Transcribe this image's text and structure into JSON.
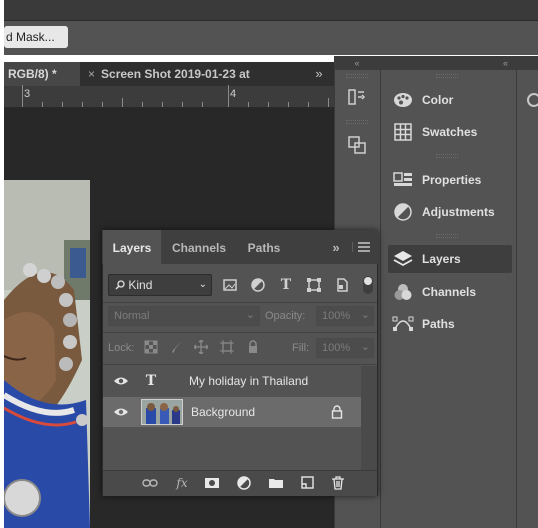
{
  "options_bar": {
    "mask_button": "d Mask..."
  },
  "tabs": {
    "active": "RGB/8) *",
    "inactive": "Screen Shot 2019-01-23 at",
    "close_glyph": "×",
    "overflow": "»"
  },
  "ruler": {
    "marks": [
      "3",
      "4"
    ]
  },
  "collapse": {
    "left": "«",
    "right": "«"
  },
  "right_panel": {
    "items": [
      {
        "label": "Color",
        "icon": "color-palette-icon"
      },
      {
        "label": "Swatches",
        "icon": "swatches-grid-icon"
      },
      {
        "label": "Properties",
        "icon": "properties-icon"
      },
      {
        "label": "Adjustments",
        "icon": "adjustments-circle-icon"
      },
      {
        "label": "Layers",
        "icon": "layers-stack-icon",
        "selected": true
      },
      {
        "label": "Channels",
        "icon": "channels-icon"
      },
      {
        "label": "Paths",
        "icon": "paths-icon"
      }
    ]
  },
  "layers_panel": {
    "tabs": [
      "Layers",
      "Channels",
      "Paths"
    ],
    "menu_glyph": "»",
    "filter": {
      "label": "Kind"
    },
    "blend_mode": "Normal",
    "opacity_label": "Opacity:",
    "opacity_value": "100%",
    "lock_label": "Lock:",
    "fill_label": "Fill:",
    "fill_value": "100%",
    "layers": [
      {
        "name": "My holiday in Thailand",
        "type": "text",
        "glyph": "T"
      },
      {
        "name": "Background",
        "type": "image",
        "locked": true,
        "selected": true
      }
    ],
    "fx_label": "fx"
  },
  "colors": {
    "panel_bg": "#535353",
    "dark_bg": "#282828",
    "selected_row": "#6b6b6b",
    "text": "#e0e0e0"
  }
}
